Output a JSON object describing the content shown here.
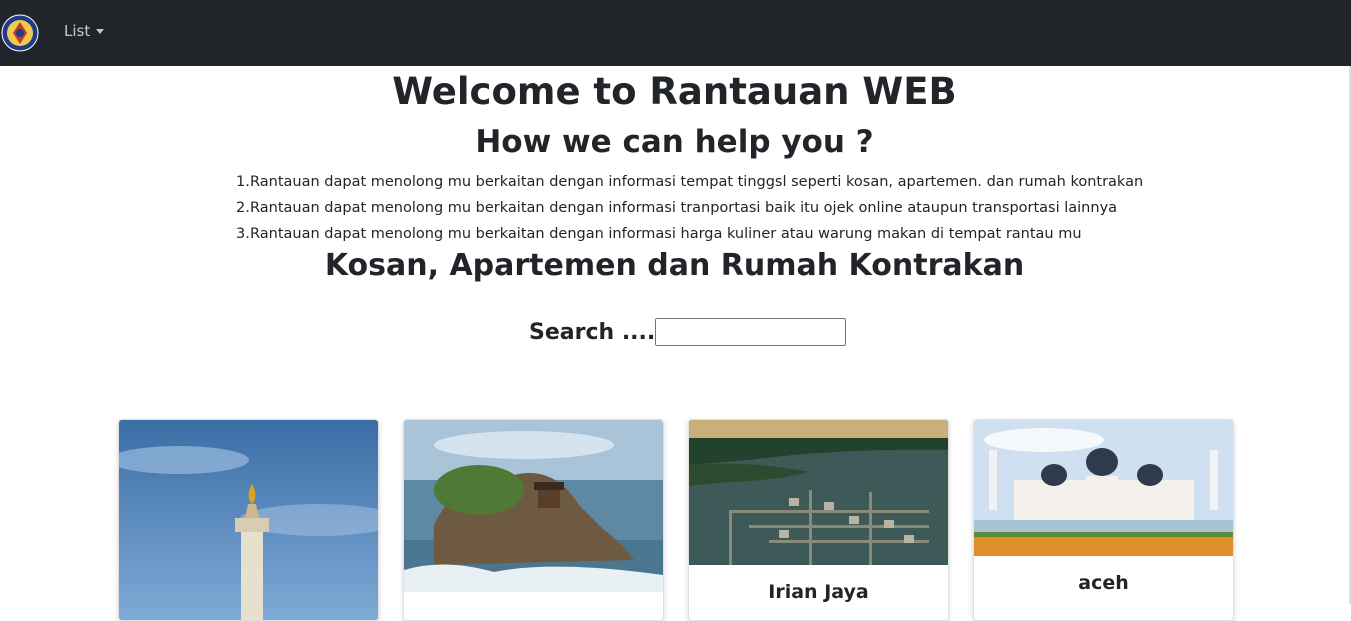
{
  "navbar": {
    "menu_label": "List"
  },
  "welcome": {
    "title": "Welcome to Rantauan WEB",
    "subtitle": "How we can help you ?"
  },
  "help_items": [
    "Rantauan dapat menolong mu berkaitan dengan informasi tempat tinggsl seperti kosan, apartemen. dan rumah kontrakan",
    "Rantauan dapat menolong mu berkaitan dengan informasi tranportasi baik itu ojek online ataupun transportasi lainnya",
    "Rantauan dapat menolong mu berkaitan dengan informasi harga kuliner atau warung makan di tempat rantau mu"
  ],
  "help_numbers": [
    "1.",
    "2.",
    "3."
  ],
  "section": {
    "title": "Kosan, Apartemen dan Rumah Kontrakan"
  },
  "search": {
    "label": "Search ....",
    "value": ""
  },
  "cards": [
    {
      "title": "",
      "image": "monas-monument"
    },
    {
      "title": "",
      "image": "tanah-lot-temple"
    },
    {
      "title": "Irian Jaya",
      "image": "floating-village"
    },
    {
      "title": "aceh",
      "image": "baiturrahman-mosque"
    }
  ]
}
